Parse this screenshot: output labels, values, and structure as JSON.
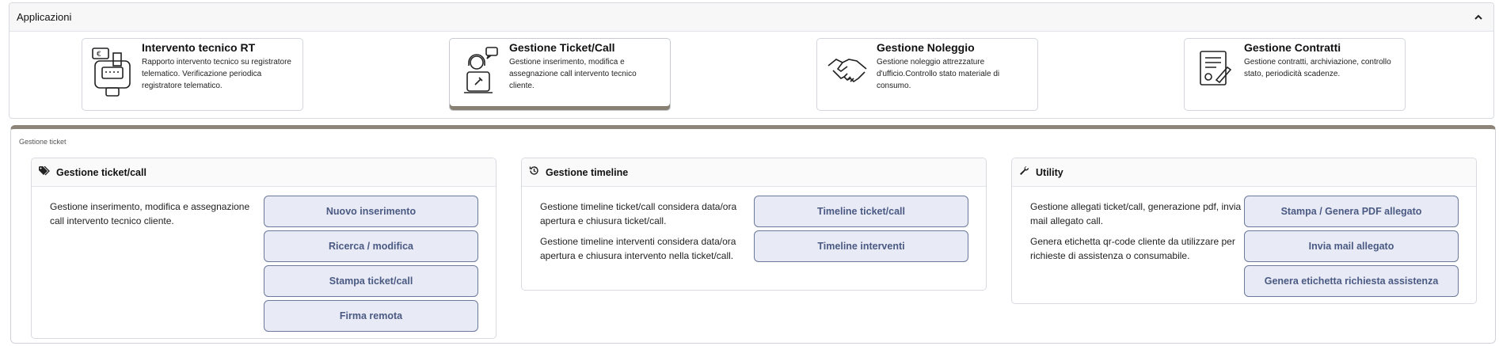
{
  "applications": {
    "title": "Applicazioni",
    "cards": [
      {
        "title": "Intervento tecnico RT",
        "desc": "Rapporto intervento tecnico su registratore telematico. Verificazione periodica registratore telematico.",
        "icon": "cash-register-icon"
      },
      {
        "title": "Gestione Ticket/Call",
        "desc": "Gestione inserimento, modifica e assegnazione call intervento tecnico cliente.",
        "icon": "support-agent-icon"
      },
      {
        "title": "Gestione Noleggio",
        "desc": "Gestione noleggio attrezzature d'ufficio.Controllo stato materiale di consumo.",
        "icon": "handshake-icon"
      },
      {
        "title": "Gestione Contratti",
        "desc": "Gestione contratti, archiviazione, controllo stato, periodicità scadenze.",
        "icon": "contract-icon"
      }
    ]
  },
  "ticket": {
    "title": "Gestione ticket",
    "boxes": [
      {
        "title": "Gestione ticket/call",
        "icon": "tags-icon",
        "texts": [
          "Gestione inserimento, modifica e assegnazione call intervento tecnico cliente."
        ],
        "buttons": [
          "Nuovo inserimento",
          "Ricerca / modifica",
          "Stampa ticket/call",
          "Firma remota"
        ]
      },
      {
        "title": "Gestione timeline",
        "icon": "history-icon",
        "texts": [
          "Gestione timeline ticket/call considera data/ora apertura e chiusura ticket/call.",
          "Gestione timeline interventi considera data/ora apertura e chiusura intervento nella ticket/call."
        ],
        "buttons": [
          "Timeline ticket/call",
          "Timeline interventi"
        ]
      },
      {
        "title": "Utility",
        "icon": "wrench-icon",
        "texts": [
          "Gestione allegati ticket/call, generazione pdf, invia mail allegato call.",
          "Genera etichetta qr-code cliente da utilizzare per richieste di assistenza o consumabile."
        ],
        "buttons": [
          "Stampa / Genera PDF allegato",
          "Invia mail allegato",
          "Genera etichetta richiesta assistenza"
        ]
      }
    ]
  },
  "colors": {
    "accent": "#8c8577",
    "button_bg": "#e8eaf6",
    "button_text": "#4a5a82"
  }
}
